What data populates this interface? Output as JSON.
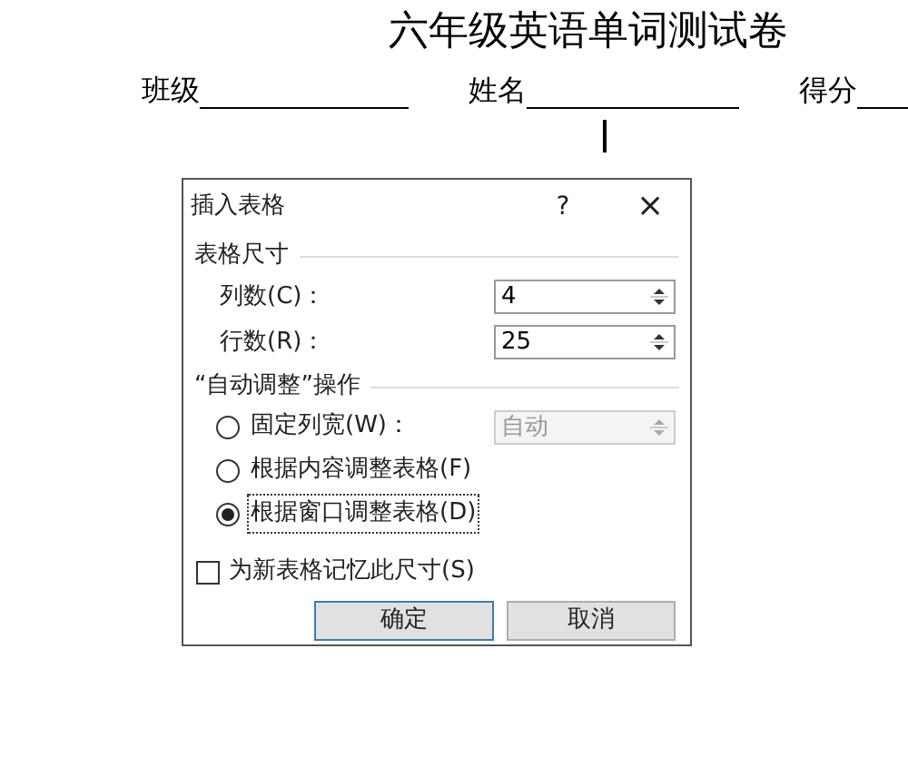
{
  "document": {
    "title": "六年级英语单词测试卷",
    "fields": [
      {
        "label": "班级"
      },
      {
        "label": "姓名"
      },
      {
        "label": "得分"
      }
    ]
  },
  "dialog": {
    "title": "插入表格",
    "help": "?",
    "close": "×",
    "size_section": {
      "title": "表格尺寸",
      "spinners": [
        {
          "label": "列数(C)：",
          "value": "4"
        },
        {
          "label": "行数(R)：",
          "value": "25"
        }
      ]
    },
    "autofit_section": {
      "title": "“自动调整”操作",
      "options": [
        {
          "label": "固定列宽(W)：",
          "selected": false,
          "field": {
            "value": "自动",
            "disabled": true
          }
        },
        {
          "label": "根据内容调整表格(F)",
          "selected": false
        },
        {
          "label": "根据窗口调整表格(D)",
          "selected": true
        }
      ]
    },
    "remember": {
      "label": "为新表格记忆此尺寸(S)",
      "checked": false
    },
    "buttons": [
      {
        "label": "确定",
        "default": true
      },
      {
        "label": "取消",
        "default": false
      }
    ]
  }
}
